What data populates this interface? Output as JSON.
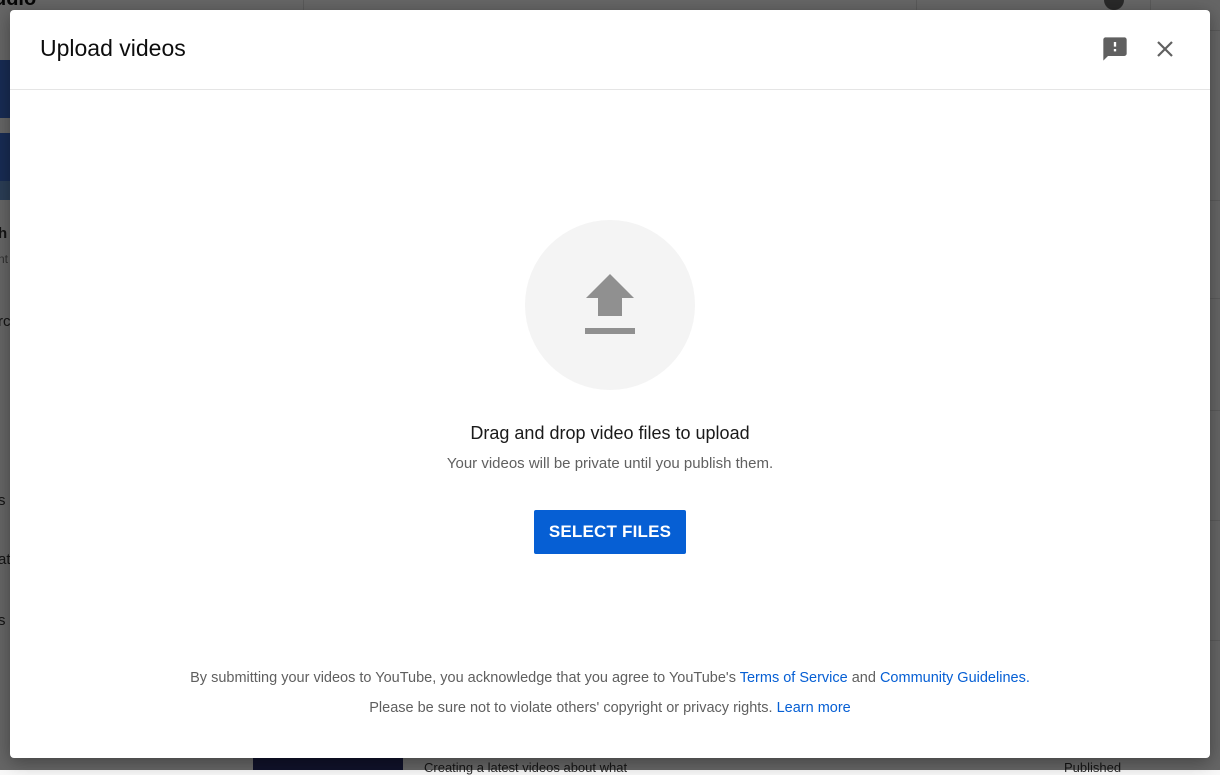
{
  "background": {
    "logo_fragment": "udio",
    "side_letters": [
      "h",
      "nt",
      "rc",
      "s",
      "at",
      "s",
      ""
    ],
    "bottom_fragments": [
      "Creating a latest videos about what",
      "Published"
    ]
  },
  "dialog": {
    "title": "Upload videos",
    "feedback_icon": "feedback-icon",
    "close_icon": "close-icon",
    "upload_icon": "upload-arrow-icon",
    "drag_title": "Drag and drop video files to upload",
    "drag_subtitle": "Your videos will be private until you publish them.",
    "select_files_label": "SELECT FILES",
    "legal_line1_prefix": "By submitting your videos to YouTube, you acknowledge that you agree to YouTube's ",
    "terms_link": "Terms of Service",
    "legal_line1_and": " and ",
    "guidelines_link": "Community Guidelines",
    "legal_line1_suffix": ".",
    "legal_line2_prefix": "Please be sure not to violate others' copyright or privacy rights. ",
    "learn_more_link": "Learn more"
  },
  "colors": {
    "accent": "#065fd4",
    "title_text": "#0d0d0d",
    "secondary_text": "#606060",
    "icon_gray": "#909090",
    "upload_circle_bg": "#f4f4f4"
  }
}
